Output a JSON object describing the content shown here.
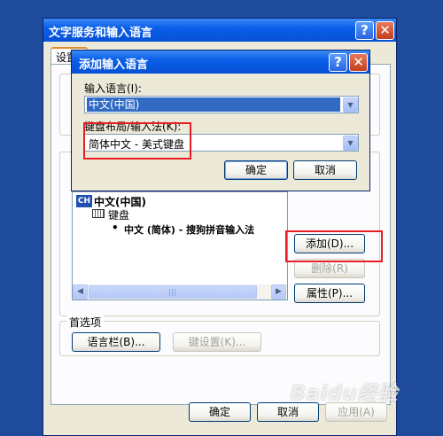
{
  "main": {
    "title": "文字服务和输入语言",
    "tab_label": "设置",
    "preferences_label": "首选项",
    "lang_bar_button": "语言栏(B)...",
    "key_settings_button": "键设置(K)...",
    "add_button": "添加(D)...",
    "remove_button": "删除(R)",
    "properties_button": "属性(P)...",
    "ok_button": "确定",
    "cancel_button": "取消",
    "apply_button": "应用(A)",
    "tree": {
      "lang_badge": "CH",
      "lang": "中文(中国)",
      "keyboard": "键盘",
      "ime": "中文 (简体) - 搜狗拼音输入法"
    }
  },
  "dialog": {
    "title": "添加输入语言",
    "input_lang_label": "输入语言(I):",
    "input_lang_value": "中文(中国)",
    "keyboard_label": "键盘布局/输入法(K):",
    "keyboard_value": "简体中文 - 美式键盘",
    "ok_button": "确定",
    "cancel_button": "取消"
  },
  "watermark": "Baidu经验",
  "colors": {
    "titlebar": "#0a5fe8",
    "desktop": "#1e4b9c",
    "highlight": "#e81c24",
    "selection": "#316ac5"
  }
}
